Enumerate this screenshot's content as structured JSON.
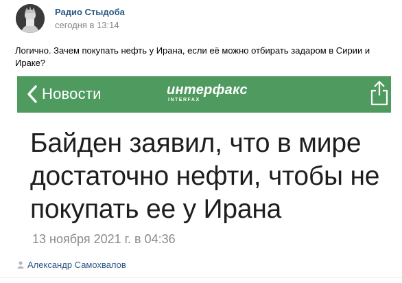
{
  "post": {
    "author": "Радио Стыдоба",
    "timestamp": "сегодня в 13:14",
    "text": "Логично. Зачем покупать нефть у Ирана, если её можно отбирать задаром в Сирии и Ираке?",
    "signer": "Александр Самохвалов"
  },
  "card": {
    "back_label": "Новости",
    "logo_text": "интерфакс",
    "logo_subtext": "INTERFAX",
    "headline": "Байден заявил, что в мире достаточно нефти, чтобы не покупать ее у Ирана",
    "date": "13 ноября 2021 г. в 04:36"
  },
  "colors": {
    "link": "#2a5885",
    "nav_bar": "#4f9b5f",
    "muted": "#828282"
  },
  "icons": {
    "back": "chevron-left-icon",
    "share": "share-icon",
    "signer": "user-icon"
  }
}
